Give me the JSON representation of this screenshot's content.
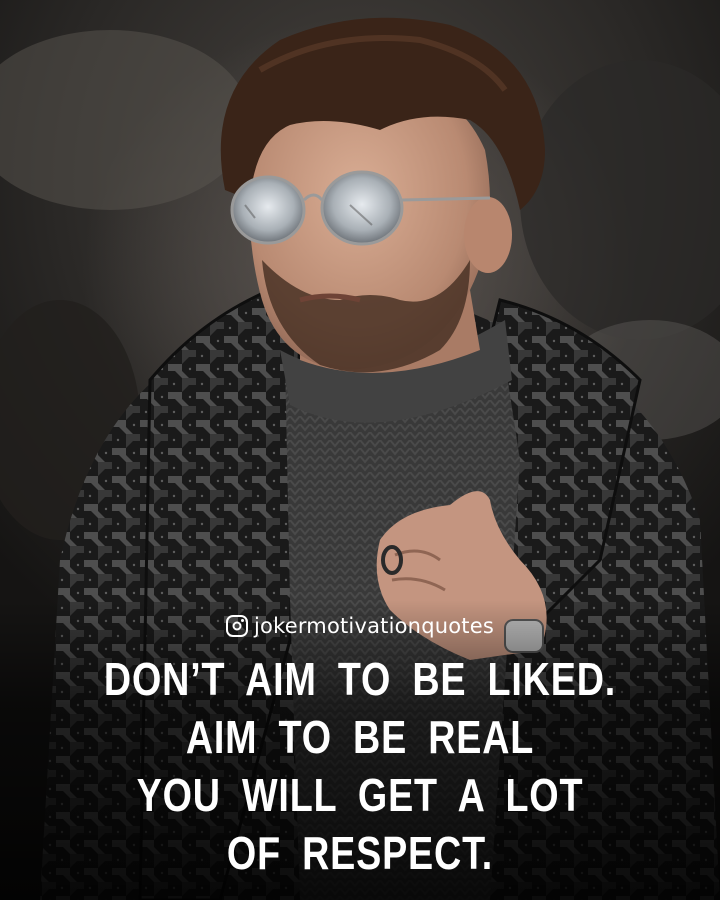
{
  "image": {
    "subject": "man-portrait",
    "palette": {
      "background": "#3e3a37",
      "coat": "#1c1c1c",
      "coat_pattern": "#6a6a6a",
      "sweater": "#3b3b3b",
      "skin": "#c79b83",
      "hair": "#3a2418",
      "lens": "#c9ced3"
    }
  },
  "overlay": {
    "instagram_icon": "instagram-icon",
    "handle": "jokermotivationquotes",
    "quote_lines": [
      "DON’T AIM TO BE LIKED.",
      "AIM TO BE REAL",
      "YOU WILL GET A LOT",
      "OF RESPECT."
    ],
    "text_color": "#ffffff"
  }
}
